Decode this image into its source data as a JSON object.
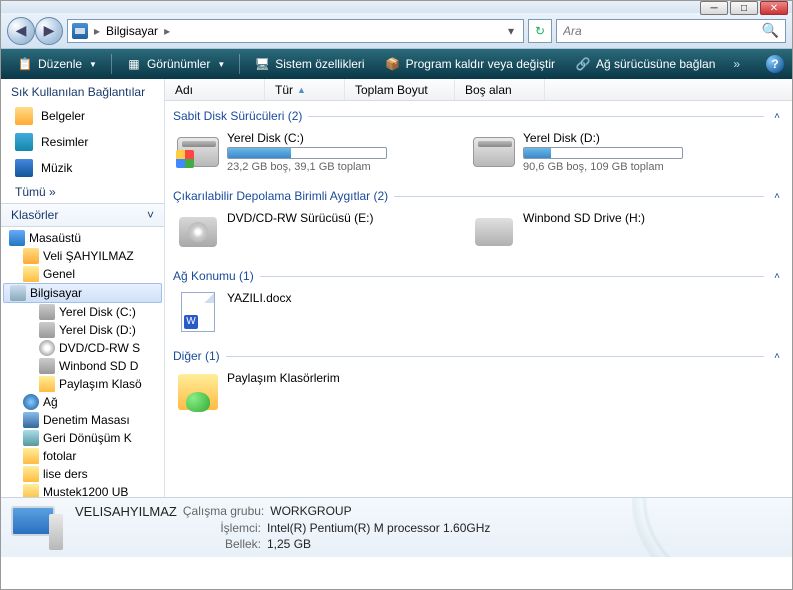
{
  "window": {
    "min": "─",
    "max": "□",
    "close": "✕"
  },
  "nav": {
    "back": "◀",
    "fwd": "▶",
    "path_root": "Bilgisayar",
    "sep": "▸",
    "dropdown": "▾",
    "refresh": "↻",
    "search_placeholder": "Ara",
    "search_icon": "🔍"
  },
  "toolbar": {
    "organize": "Düzenle",
    "views": "Görünümler",
    "sysprops": "Sistem özellikleri",
    "uninstall": "Program kaldır veya değiştir",
    "mapdrive": "Ağ sürücüsüne bağlan",
    "more": "»",
    "help": "?"
  },
  "favorites": {
    "header": "Sık Kullanılan Bağlantılar",
    "docs": "Belgeler",
    "pics": "Resimler",
    "music": "Müzik",
    "more": "Tümü »"
  },
  "folders": {
    "header": "Klasörler",
    "collapse": "˅",
    "items": [
      {
        "label": "Masaüstü",
        "cls": "desktop",
        "ind": 0
      },
      {
        "label": "Veli ŞAHYILMAZ",
        "cls": "user",
        "ind": 1
      },
      {
        "label": "Genel",
        "cls": "folder",
        "ind": 1
      },
      {
        "label": "Bilgisayar",
        "cls": "computer",
        "ind": 1,
        "sel": true
      },
      {
        "label": "Yerel Disk (C:)",
        "cls": "drive",
        "ind": 2
      },
      {
        "label": "Yerel Disk (D:)",
        "cls": "drive",
        "ind": 2
      },
      {
        "label": "DVD/CD-RW S",
        "cls": "cd",
        "ind": 2
      },
      {
        "label": "Winbond SD D",
        "cls": "drive",
        "ind": 2
      },
      {
        "label": "Paylaşım Klasö",
        "cls": "folder",
        "ind": 2
      },
      {
        "label": "Ağ",
        "cls": "net",
        "ind": 1
      },
      {
        "label": "Denetim Masası",
        "cls": "cp",
        "ind": 1
      },
      {
        "label": "Geri Dönüşüm K",
        "cls": "trash",
        "ind": 1
      },
      {
        "label": "fotolar",
        "cls": "folder",
        "ind": 1
      },
      {
        "label": "lise ders",
        "cls": "folder",
        "ind": 1
      },
      {
        "label": "Mustek1200 UB",
        "cls": "folder",
        "ind": 1
      }
    ]
  },
  "columns": {
    "name": "Adı",
    "type": "Tür",
    "total": "Toplam Boyut",
    "free": "Boş alan"
  },
  "groups": {
    "hdd": {
      "title": "Sabit Disk Sürücüleri (2)",
      "c": {
        "name": "Yerel Disk (C:)",
        "info": "23,2 GB boş, 39,1 GB toplam",
        "pct": 40
      },
      "d": {
        "name": "Yerel Disk (D:)",
        "info": "90,6 GB boş, 109 GB toplam",
        "pct": 17
      }
    },
    "removable": {
      "title": "Çıkarılabilir Depolama Birimli Aygıtlar (2)",
      "dvd": "DVD/CD-RW Sürücüsü (E:)",
      "sd": "Winbond SD Drive (H:)"
    },
    "network": {
      "title": "Ağ Konumu (1)",
      "file": "YAZILI.docx"
    },
    "other": {
      "title": "Diğer (1)",
      "share": "Paylaşım Klasörlerim"
    }
  },
  "status": {
    "pcname": "VELISAHYILMAZ",
    "workgroup_l": "Çalışma grubu:",
    "workgroup_v": "WORKGROUP",
    "cpu_l": "İşlemci:",
    "cpu_v": "Intel(R) Pentium(R) M processor 1.60GHz",
    "mem_l": "Bellek:",
    "mem_v": "1,25 GB"
  }
}
